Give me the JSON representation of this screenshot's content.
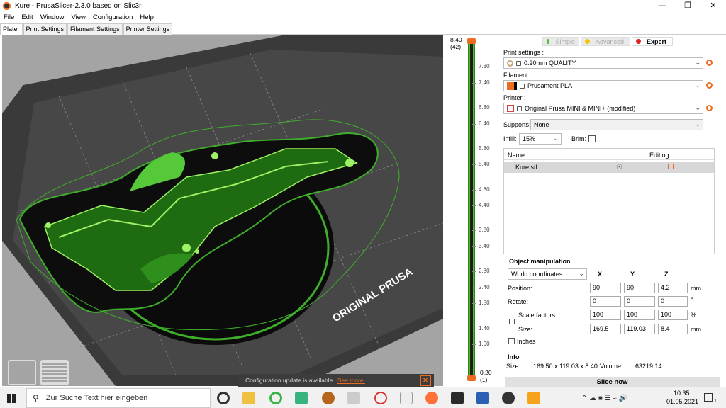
{
  "window": {
    "title": "Kure - PrusaSlicer-2.3.0 based on Slic3r"
  },
  "menu": [
    "File",
    "Edit",
    "Window",
    "View",
    "Configuration",
    "Help"
  ],
  "tabs": [
    "Plater",
    "Print Settings",
    "Filament Settings",
    "Printer Settings"
  ],
  "viewport": {
    "bed_label": "ORIGINAL PRUSA"
  },
  "notification": {
    "text": "Configuration update is available.",
    "link": "See more."
  },
  "layers": {
    "top_value": "8.40",
    "top_layer": "(42)",
    "bottom_value": "0.20",
    "bottom_layer": "(1)",
    "ticks": [
      "7.80",
      "7.40",
      "6.80",
      "6.40",
      "5.80",
      "5.40",
      "4.80",
      "4.40",
      "3.80",
      "3.40",
      "2.80",
      "2.40",
      "1.80",
      "1.40",
      "1.00"
    ]
  },
  "modes": {
    "simple": "Simple",
    "advanced": "Advanced",
    "expert": "Expert"
  },
  "settings": {
    "print_label": "Print settings :",
    "print_value": "0.20mm QUALITY",
    "filament_label": "Filament :",
    "filament_value": "Prusament PLA",
    "filament_color": "#ed6b21",
    "printer_label": "Printer :",
    "printer_value": "Original Prusa MINI & MINI+ (modified)",
    "supports_label": "Supports:",
    "supports_value": "None",
    "infill_label": "Infill:",
    "infill_value": "15%",
    "brim_label": "Brim:"
  },
  "object_list": {
    "col_name": "Name",
    "col_editing": "Editing",
    "items": [
      "Kure.stl"
    ]
  },
  "manipulation": {
    "title": "Object manipulation",
    "coords": "World coordinates",
    "x": "X",
    "y": "Y",
    "z": "Z",
    "position_label": "Position:",
    "position": [
      "90",
      "90",
      "4.2"
    ],
    "position_unit": "mm",
    "rotate_label": "Rotate:",
    "rotate": [
      "0",
      "0",
      "0"
    ],
    "rotate_unit": "°",
    "scale_label": "Scale factors:",
    "scale": [
      "100",
      "100",
      "100"
    ],
    "scale_unit": "%",
    "size_label": "Size:",
    "size": [
      "169.5",
      "119.03",
      "8.4"
    ],
    "size_unit": "mm",
    "inches_label": "Inches"
  },
  "info": {
    "title": "Info",
    "size_label": "Size:",
    "size_value": "169.50 x 119.03 x 8.40",
    "volume_label": "Volume:",
    "volume_value": "63219.14"
  },
  "slice_button": "Slice now",
  "taskbar": {
    "search_placeholder": "Zur Suche Text hier eingeben",
    "time": "10:35",
    "date": "01.05.2021",
    "notif_count": "1"
  }
}
